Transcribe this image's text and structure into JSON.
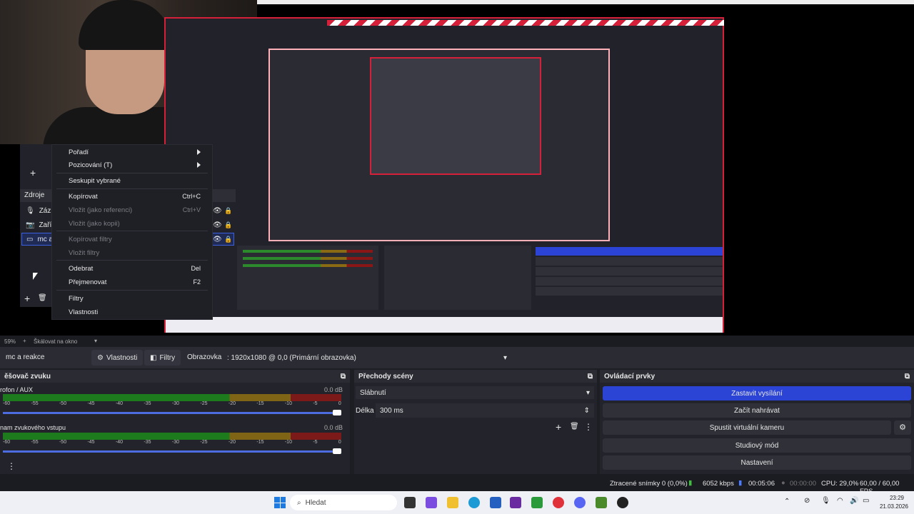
{
  "context_menu": {
    "items": [
      {
        "label": "Pořadí",
        "shortcut": "",
        "disabled": false,
        "submenu": true
      },
      {
        "label": "Pozicování (T)",
        "shortcut": "",
        "disabled": false,
        "submenu": true
      },
      {
        "label": "Seskupit vybrané",
        "shortcut": "",
        "disabled": false
      },
      {
        "label": "Kopírovat",
        "shortcut": "Ctrl+C",
        "disabled": false
      },
      {
        "label": "Vložit (jako referenci)",
        "shortcut": "Ctrl+V",
        "disabled": true
      },
      {
        "label": "Vložit (jako kopii)",
        "shortcut": "",
        "disabled": true
      },
      {
        "label": "Kopírovat filtry",
        "shortcut": "",
        "disabled": true
      },
      {
        "label": "Vložit filtry",
        "shortcut": "",
        "disabled": true
      },
      {
        "label": "Odebrat",
        "shortcut": "Del",
        "disabled": false
      },
      {
        "label": "Přejmenovat",
        "shortcut": "F2",
        "disabled": false
      },
      {
        "label": "Filtry",
        "shortcut": "",
        "disabled": false
      },
      {
        "label": "Vlastnosti",
        "shortcut": "",
        "disabled": false
      }
    ]
  },
  "sources": {
    "title": "Zdroje",
    "items": [
      "Zázna",
      "Zaříz",
      "mc a"
    ]
  },
  "zoom": {
    "percent": "59%",
    "mode": "Škálovat na okno"
  },
  "toolbar": {
    "source_name": "mc a reakce",
    "properties_label": "Vlastnosti",
    "filters_label": "Filtry",
    "display_label": "Obrazovka",
    "display_value": ": 1920x1080 @ 0,0 (Primární obrazovka)"
  },
  "mixer": {
    "title": "ěšovač zvuku",
    "channels": [
      {
        "name": "rofon / AUX",
        "db": "0.0 dB"
      },
      {
        "name": "nam zvukového vstupu",
        "db": "0.0 dB"
      }
    ],
    "ticks": [
      "-60",
      "-55",
      "-50",
      "-45",
      "-40",
      "-35",
      "-30",
      "-25",
      "-20",
      "-15",
      "-10",
      "-5",
      "0"
    ]
  },
  "transitions": {
    "title": "Přechody scény",
    "selected": "Slábnutí",
    "duration_label": "Délka",
    "duration_value": "300 ms"
  },
  "controls": {
    "title": "Ovládací prvky",
    "buttons": [
      "Zastavit vysílání",
      "Začít nahrávat",
      "Spustit virtuální kameru",
      "Studiový mód",
      "Nastavení"
    ]
  },
  "status": {
    "dropped": "Ztracené snímky 0 (0,0%)",
    "kbps": "6052 kbps",
    "stream_time": "00:05:06",
    "rec_time": "00:00:00",
    "cpu": "CPU: 29,0%",
    "fps": "60,00 / 60,00 FPS"
  },
  "taskbar": {
    "search_placeholder": "Hledat",
    "time": "23:29",
    "date": "21.03.2026"
  },
  "colors": {
    "accent": "#2b44d6",
    "record_red": "#d6203a",
    "bg": "#1d1e24"
  }
}
